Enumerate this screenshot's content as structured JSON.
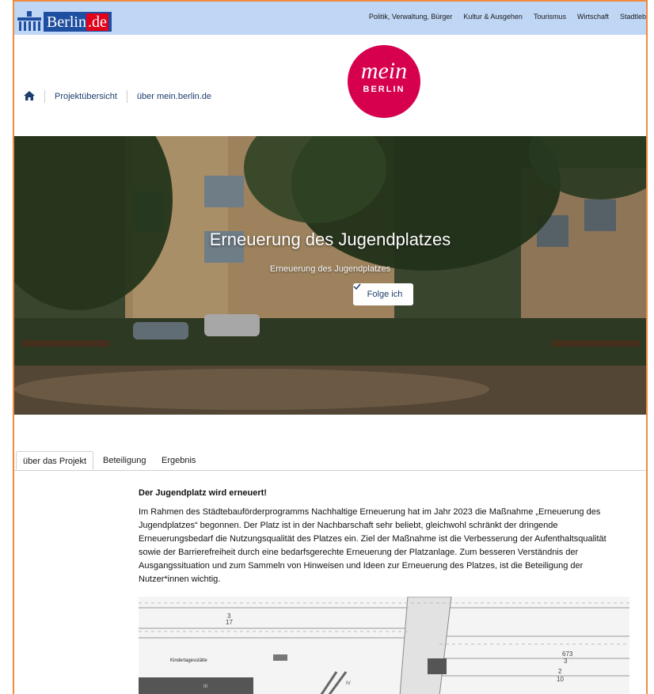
{
  "topbar": {
    "logo_text": "Berlin",
    "logo_suffix": ".de",
    "nav": [
      "Politik, Verwaltung, Bürger",
      "Kultur & Ausgehen",
      "Tourismus",
      "Wirtschaft",
      "Stadtleb"
    ]
  },
  "header": {
    "breadcrumb": {
      "home_icon": "home-icon",
      "items": [
        "Projektübersicht",
        "über mein.berlin.de"
      ]
    },
    "brand": {
      "line1": "mein",
      "line2": "BERLIN",
      "color": "#d6004f"
    }
  },
  "hero": {
    "title": "Erneuerung des Jugendplatzes",
    "subtitle": "Erneuerung des Jugendplatzes",
    "follow_label": "Folge ich",
    "follow_icon": "check-icon"
  },
  "tabs": [
    "über das Projekt",
    "Beteiligung",
    "Ergebnis"
  ],
  "content": {
    "heading": "Der Jugendplatz wird erneuert!",
    "body": "Im Rahmen des Städtebauförderprogramms Nachhaltige Erneuerung hat im Jahr 2023 die Maßnahme „Erneuerung des Jugendplatzes“ begonnen. Der Platz ist in der Nachbarschaft sehr beliebt, gleichwohl schränkt der dringende Erneuerungsbedarf die Nutzungsqualität des Platzes ein. Ziel der Maßnahme ist die Verbesserung der Aufenthaltsqualität sowie der Barrierefreiheit durch eine bedarfsgerechte Erneuerung der Platzanlage. Zum besseren Verständnis der Ausgangssituation und zum Sammeln von Hinweisen und Ideen zur Erneuerung des Platzes, ist die Beteiligung der Nutzer*innen wichtig."
  },
  "map": {
    "labels": [
      "3",
      "17",
      "Kindertagesstätte",
      "673",
      "3",
      "2",
      "10",
      "IV",
      "III"
    ]
  }
}
